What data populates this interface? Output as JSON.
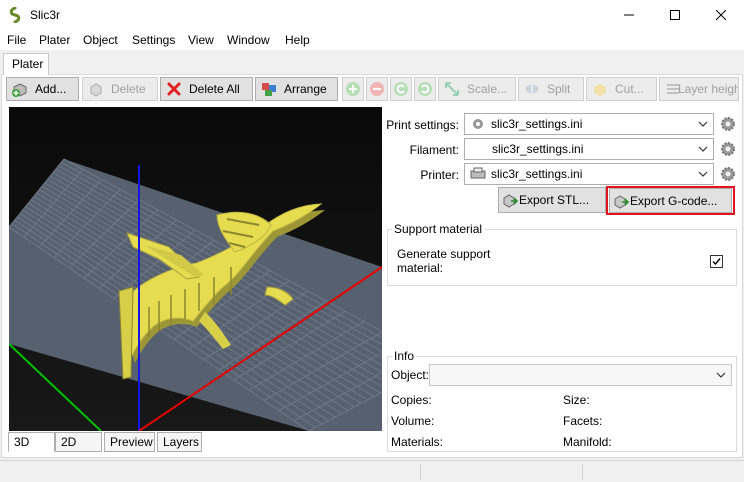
{
  "window": {
    "title": "Slic3r"
  },
  "menu": {
    "items": [
      "File",
      "Plater",
      "Object",
      "Settings",
      "View",
      "Window",
      "Help"
    ]
  },
  "tabs": {
    "plater": "Plater"
  },
  "toolbar": {
    "add": "Add...",
    "delete": "Delete",
    "delete_all": "Delete All",
    "arrange": "Arrange",
    "scale": "Scale...",
    "split": "Split",
    "cut": "Cut...",
    "layer_heights": "Layer heights"
  },
  "view_tabs": [
    "3D",
    "2D",
    "Preview",
    "Layers"
  ],
  "settings": {
    "print_label": "Print settings:",
    "print_value": "slic3r_settings.ini",
    "filament_label": "Filament:",
    "filament_value": "slic3r_settings.ini",
    "printer_label": "Printer:",
    "printer_value": "slic3r_settings.ini"
  },
  "export": {
    "stl": "Export STL...",
    "gcode": "Export G-code..."
  },
  "support": {
    "title": "Support material",
    "generate_label_1": "Generate support",
    "generate_label_2": "material:",
    "checked": true
  },
  "info": {
    "title": "Info",
    "object_label": "Object:",
    "copies": "Copies:",
    "size": "Size:",
    "volume": "Volume:",
    "facets": "Facets:",
    "materials": "Materials:",
    "manifold": "Manifold:"
  },
  "colors": {
    "model": "#e6dc50",
    "bed": "#5a6473",
    "highlight": "#e0141e",
    "axis_x": "#e60000",
    "axis_y": "#00b400",
    "axis_z": "#0000e6"
  }
}
